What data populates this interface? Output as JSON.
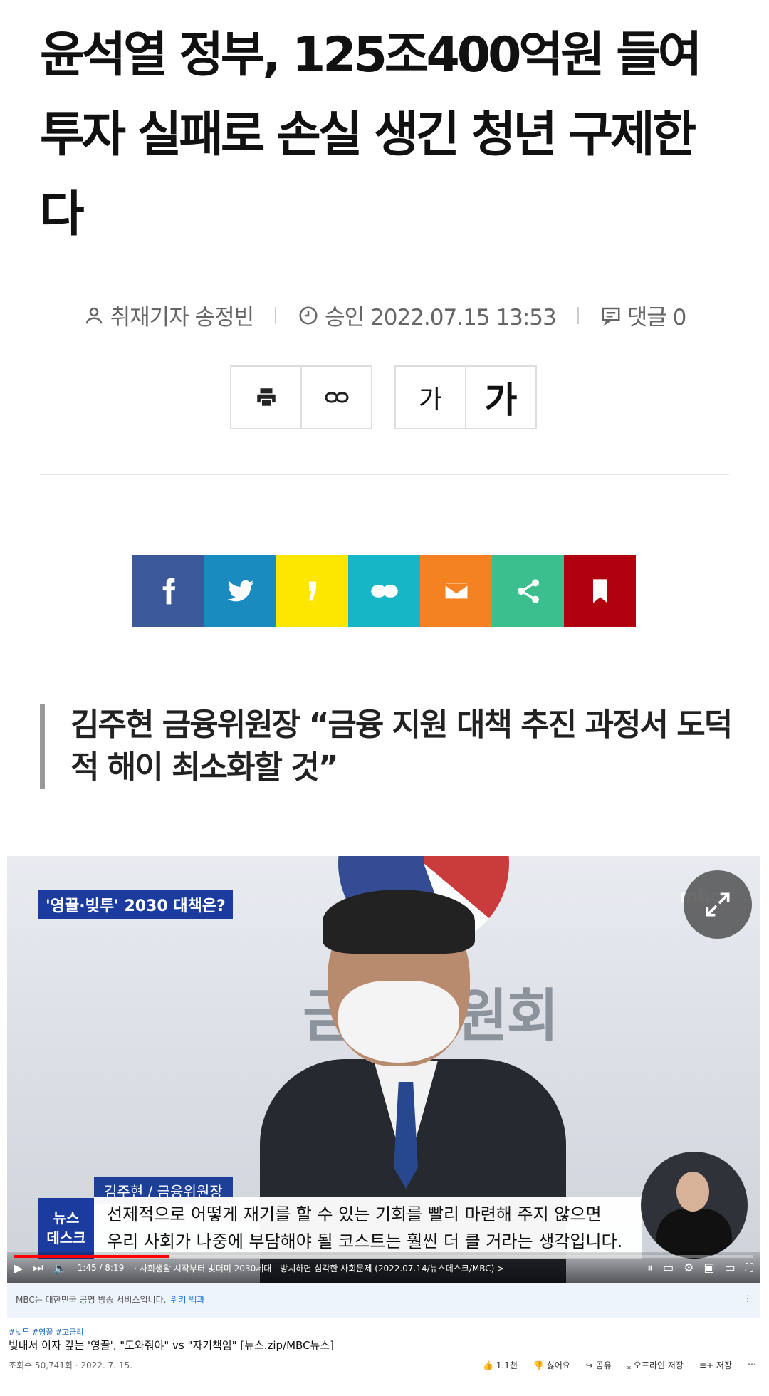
{
  "article": {
    "headline_line1": "윤석열 정부, 125조400억원 들여",
    "headline_line2": "투자 실패로 손실 생긴 청년 구제한",
    "headline_line3": "다"
  },
  "meta": {
    "reporter": "취재기자 송정빈",
    "approved": "승인 2022.07.15 13:53",
    "comments": "댓글 0"
  },
  "toolbar": {
    "font_small": "가",
    "font_large": "가"
  },
  "share": {
    "colors": [
      "#3b5998",
      "#1a8bbf",
      "#fde700",
      "#16b6c6",
      "#f58220",
      "#3cbf8f",
      "#b00010"
    ],
    "icons": [
      "facebook-icon",
      "twitter-icon",
      "kakaostory-icon",
      "link-icon",
      "mail-icon",
      "share-icon",
      "bookmark-icon"
    ]
  },
  "subhead": {
    "line1": "김주현 금융위원장 “금융 지원 대책 추진 과정서 도덕",
    "line2": "적 해이 최소화할 것”"
  },
  "video": {
    "topic": "'영끌·빚투' 2030 대책은?",
    "wall_text": "금융위원회",
    "caption_name": "김주현 / 금융위원장",
    "caption_line1": "선제적으로 어떻게 재기를 할 수 있는 기회를 빨리 마련해 주지 않으면",
    "caption_line2": "우리 사회가 나중에 부담해야 될 코스트는 훨씬 더 클 거라는 생각입니다.",
    "badge_line1": "뉴스",
    "badge_line2": "데스크",
    "time": "1:45 / 8:19",
    "chapter": "· 사회생활 시작부터 빚더미 2030세대 - 방치하면 심각한 사회문제 (2022.07.14/뉴스데스크/MBC) >",
    "progress": 0.21
  },
  "notice": {
    "text": "MBC는 대한민국 공영 방송 서비스입니다.",
    "link": "위키 백과"
  },
  "yt": {
    "tags": "#빚투 #영끌 #고금리",
    "title": "빚내서 이자 갚는 '영끌', \"도와줘야\" vs \"자기책임\" [뉴스.zip/MBC뉴스]",
    "views": "조회수 50,741회 · 2022. 7. 15.",
    "like": "1.1천",
    "dislike": "싫어요",
    "share": "공유",
    "offline": "오프라인 저장",
    "save": "저장"
  }
}
